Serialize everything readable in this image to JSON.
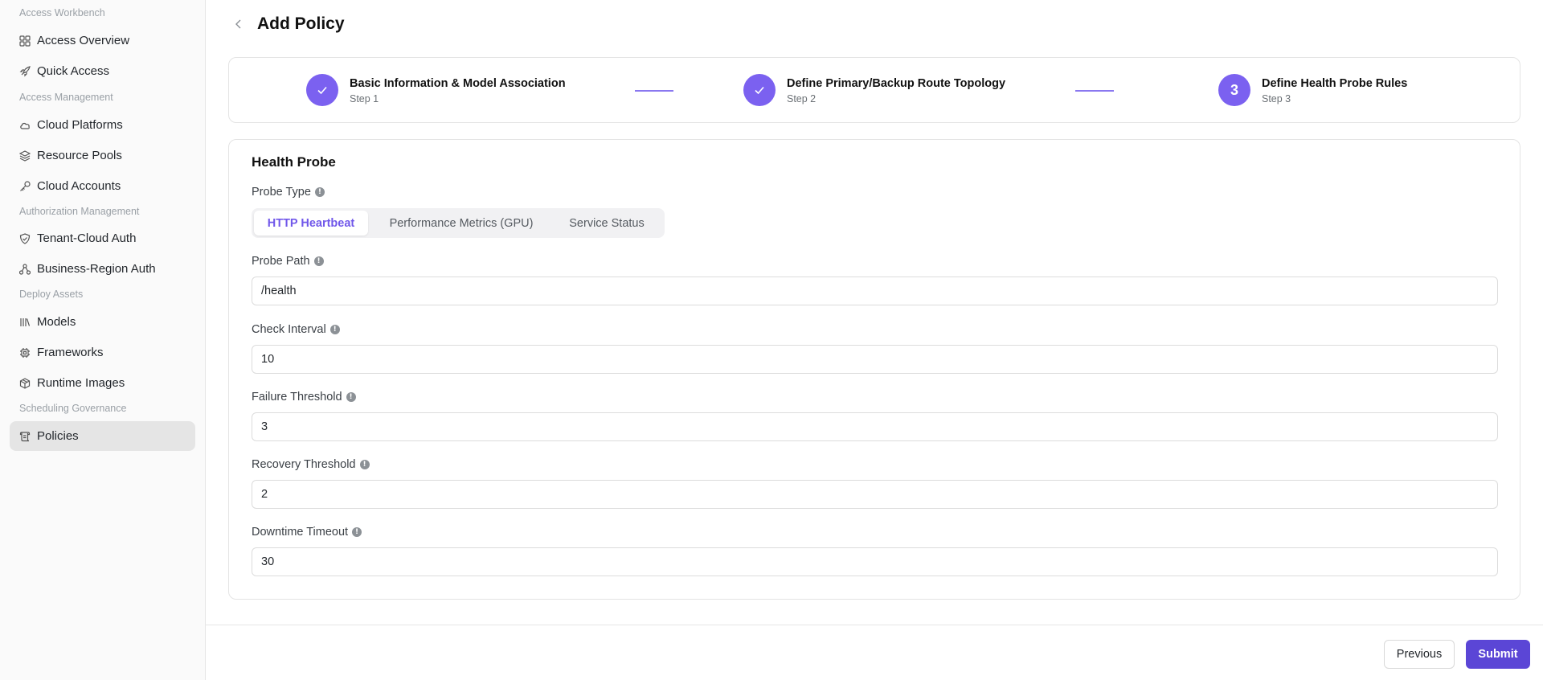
{
  "sidebar": {
    "sections": [
      {
        "label": "Access Workbench",
        "items": [
          {
            "label": "Access Overview",
            "icon": "grid-icon"
          },
          {
            "label": "Quick Access",
            "icon": "rocket-icon"
          }
        ]
      },
      {
        "label": "Access Management",
        "items": [
          {
            "label": "Cloud Platforms",
            "icon": "cloud-icon"
          },
          {
            "label": "Resource Pools",
            "icon": "layers-icon"
          },
          {
            "label": "Cloud Accounts",
            "icon": "key-icon"
          }
        ]
      },
      {
        "label": "Authorization Management",
        "items": [
          {
            "label": "Tenant-Cloud Auth",
            "icon": "shield-check-icon"
          },
          {
            "label": "Business-Region Auth",
            "icon": "network-icon"
          }
        ]
      },
      {
        "label": "Deploy Assets",
        "items": [
          {
            "label": "Models",
            "icon": "library-icon"
          },
          {
            "label": "Frameworks",
            "icon": "cpu-icon"
          },
          {
            "label": "Runtime Images",
            "icon": "package-icon"
          }
        ]
      },
      {
        "label": "Scheduling Governance",
        "items": [
          {
            "label": "Policies",
            "icon": "scroll-icon",
            "active": true
          }
        ]
      }
    ]
  },
  "header": {
    "title": "Add Policy"
  },
  "steps": [
    {
      "title": "Basic Information & Model Association",
      "sub": "Step 1",
      "state": "done"
    },
    {
      "title": "Define Primary/Backup Route Topology",
      "sub": "Step 2",
      "state": "done"
    },
    {
      "title": "Define Health Probe Rules",
      "sub": "Step 3",
      "number": "3",
      "state": "current"
    }
  ],
  "form": {
    "section_title": "Health Probe",
    "probe_type": {
      "label": "Probe Type",
      "options": [
        "HTTP Heartbeat",
        "Performance Metrics (GPU)",
        "Service Status"
      ],
      "selected": "HTTP Heartbeat"
    },
    "probe_path": {
      "label": "Probe Path",
      "value": "/health"
    },
    "check_interval": {
      "label": "Check Interval",
      "value": "10"
    },
    "failure_threshold": {
      "label": "Failure Threshold",
      "value": "3"
    },
    "recovery_threshold": {
      "label": "Recovery Threshold",
      "value": "2"
    },
    "downtime_timeout": {
      "label": "Downtime Timeout",
      "value": "30"
    }
  },
  "footer": {
    "previous_label": "Previous",
    "submit_label": "Submit"
  },
  "colors": {
    "accent": "#7b61f0",
    "submit": "#5b46d6",
    "active_tab_text": "#7158ea"
  }
}
